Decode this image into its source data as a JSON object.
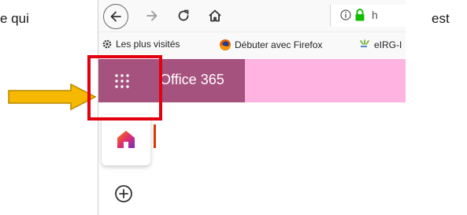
{
  "document": {
    "left_text": "e qui",
    "right_text": "est"
  },
  "browser": {
    "url_partial": "h",
    "bookmarks": [
      {
        "label": "Les plus visités",
        "icon": "gear-icon"
      },
      {
        "label": "Débuter avec Firefox",
        "icon": "firefox-icon"
      },
      {
        "label": "eIRG-I",
        "icon": "eirg-icon"
      }
    ]
  },
  "office": {
    "title": "Office 365",
    "bar_color": "#ffb3e0",
    "waffle_area_color": "#a6527f"
  },
  "annotations": {
    "arrow_color": "#f6b800",
    "highlight_color": "#e3000f"
  },
  "icons": [
    "back-arrow-icon",
    "forward-arrow-icon",
    "reload-icon",
    "home-icon",
    "info-icon",
    "lock-icon",
    "waffle-icon",
    "office-home-icon",
    "add-icon"
  ]
}
